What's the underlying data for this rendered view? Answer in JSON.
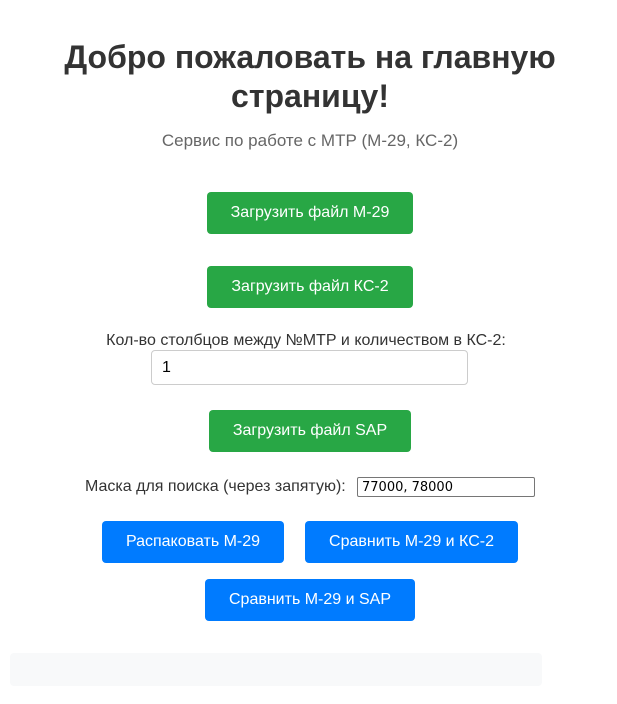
{
  "header": {
    "title": "Добро пожаловать на главную страницу!",
    "subtitle": "Сервис по работе с МТР (М-29, КС-2)"
  },
  "uploads": {
    "m29_label": "Загрузить файл М-29",
    "ks2_label": "Загрузить файл КС-2",
    "sap_label": "Загрузить файл SAP"
  },
  "columns_field": {
    "label": "Кол-во столбцов между №МТР и количеством в КС-2:",
    "value": "1"
  },
  "mask_field": {
    "label": "Маска для поиска (через запятую):",
    "value": "77000, 78000"
  },
  "actions": {
    "unpack_label": "Распаковать М-29",
    "compare_ks2_label": "Сравнить М-29 и КС-2",
    "compare_sap_label": "Сравнить М-29 и SAP"
  },
  "colors": {
    "green": "#28a745",
    "blue": "#007bff",
    "result_bg": "#f8f9fa"
  }
}
